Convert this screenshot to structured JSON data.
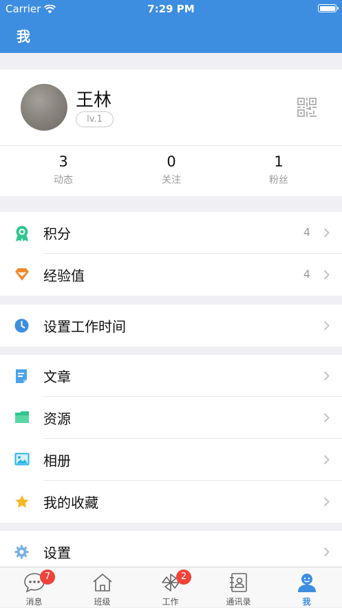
{
  "status_bar": {
    "carrier": "Carrier",
    "time": "7:29 PM"
  },
  "header": {
    "title": "我"
  },
  "profile": {
    "name": "王林",
    "level": "lv.1",
    "stats": [
      {
        "value": "3",
        "label": "动态"
      },
      {
        "value": "0",
        "label": "关注"
      },
      {
        "value": "1",
        "label": "粉丝"
      }
    ]
  },
  "menu": {
    "points": {
      "label": "积分",
      "value": "4",
      "icon": "medal-icon"
    },
    "experience": {
      "label": "经验值",
      "value": "4",
      "icon": "diamond-icon"
    },
    "work_time": {
      "label": "设置工作时间",
      "icon": "clock-icon"
    },
    "articles": {
      "label": "文章",
      "icon": "document-icon"
    },
    "resources": {
      "label": "资源",
      "icon": "folder-icon"
    },
    "album": {
      "label": "相册",
      "icon": "image-icon"
    },
    "favorites": {
      "label": "我的收藏",
      "icon": "star-icon"
    },
    "settings": {
      "label": "设置",
      "icon": "gear-icon"
    }
  },
  "tabbar": {
    "messages": {
      "label": "消息",
      "badge": "7"
    },
    "class": {
      "label": "班级"
    },
    "work": {
      "label": "工作",
      "badge": "2"
    },
    "contacts": {
      "label": "通讯录"
    },
    "me": {
      "label": "我"
    }
  },
  "colors": {
    "accent": "#3d8ee0",
    "badge": "#f0443b",
    "points_icon": "#2fc68f",
    "experience_icon": "#f08a2c",
    "star_icon": "#f6b821"
  }
}
